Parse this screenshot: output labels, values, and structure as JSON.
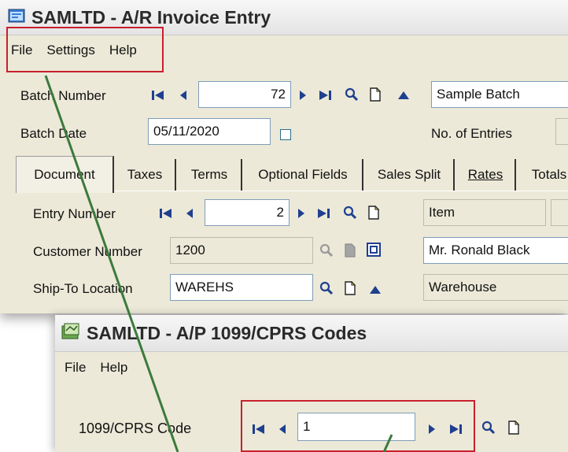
{
  "window1": {
    "title": "SAMLTD - A/R Invoice Entry",
    "menu": [
      "File",
      "Settings",
      "Help"
    ],
    "batch_number_label": "Batch Number",
    "batch_number_value": "72",
    "batch_description": "Sample Batch",
    "batch_date_label": "Batch Date",
    "batch_date_value": "05/11/2020",
    "entries_label": "No. of Entries",
    "tabs": [
      {
        "label": "Document",
        "active": true
      },
      {
        "label": "Taxes",
        "active": false
      },
      {
        "label": "Terms",
        "active": false
      },
      {
        "label": "Optional Fields",
        "active": false
      },
      {
        "label": "Sales Split",
        "active": false
      },
      {
        "label": "Rates",
        "active": false
      },
      {
        "label": "Totals",
        "active": false
      }
    ],
    "entry_number_label": "Entry Number",
    "entry_number_value": "2",
    "entry_type": "Item",
    "customer_number_label": "Customer Number",
    "customer_number_value": "1200",
    "customer_name": "Mr. Ronald Black",
    "ship_to_label": "Ship-To Location",
    "ship_to_value": "WAREHS",
    "ship_to_description": "Warehouse"
  },
  "window2": {
    "title": "SAMLTD - A/P 1099/CPRS Codes",
    "menu": [
      "File",
      "Help"
    ],
    "code_label": "1099/CPRS Code",
    "code_value": "1"
  },
  "colors": {
    "highlight": "#c8202c",
    "nav_arrow": "#1f3f8f",
    "arrow_line": "#3c7a3c"
  },
  "icons": [
    "first-record-icon",
    "previous-record-icon",
    "next-record-icon",
    "last-record-icon",
    "finder-icon",
    "new-document-icon",
    "zoom-up-icon",
    "calendar-icon"
  ]
}
